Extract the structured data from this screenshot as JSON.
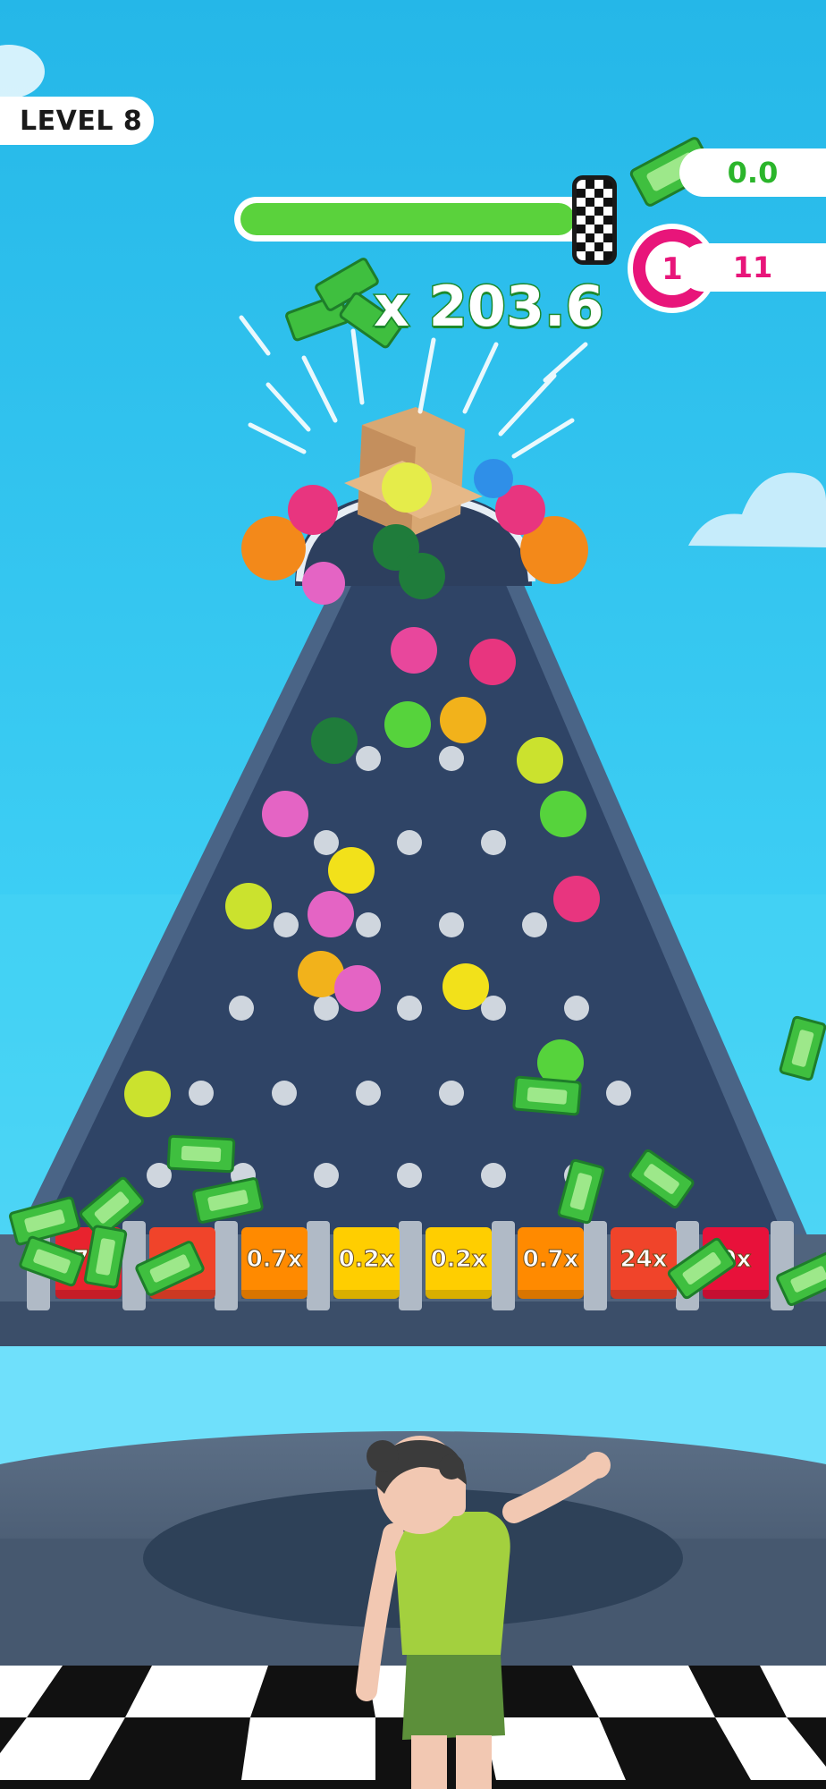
{
  "hud": {
    "level_label": "LEVEL 8",
    "cash_value": "0.0",
    "coin_count": "11",
    "coin_badge_number": "1",
    "multiplier_text": "x 203.6",
    "progress_fraction": 0.92
  },
  "slots": [
    {
      "label": "7x",
      "color": "#e8232e"
    },
    {
      "label": "x",
      "color": "#f0442a"
    },
    {
      "label": "0.7x",
      "color": "#ff8a00"
    },
    {
      "label": "0.2x",
      "color": "#ffce00"
    },
    {
      "label": "0.2x",
      "color": "#ffce00"
    },
    {
      "label": "0.7x",
      "color": "#ff8a00"
    },
    {
      "label": "24x",
      "color": "#f0442a"
    },
    {
      "label": "0x",
      "color": "#e8113a"
    }
  ],
  "colors": {
    "sky_top": "#2ec3ef",
    "sky_bottom": "#6fe0fb",
    "board": "#32486a",
    "board_edge": "#4a6486",
    "accent_green": "#5ad23c",
    "coin_pink": "#e8157a"
  },
  "icons": {
    "cash": "cash-stack-icon",
    "coin": "pink-coin-icon",
    "flag": "checkered-flag-icon"
  }
}
